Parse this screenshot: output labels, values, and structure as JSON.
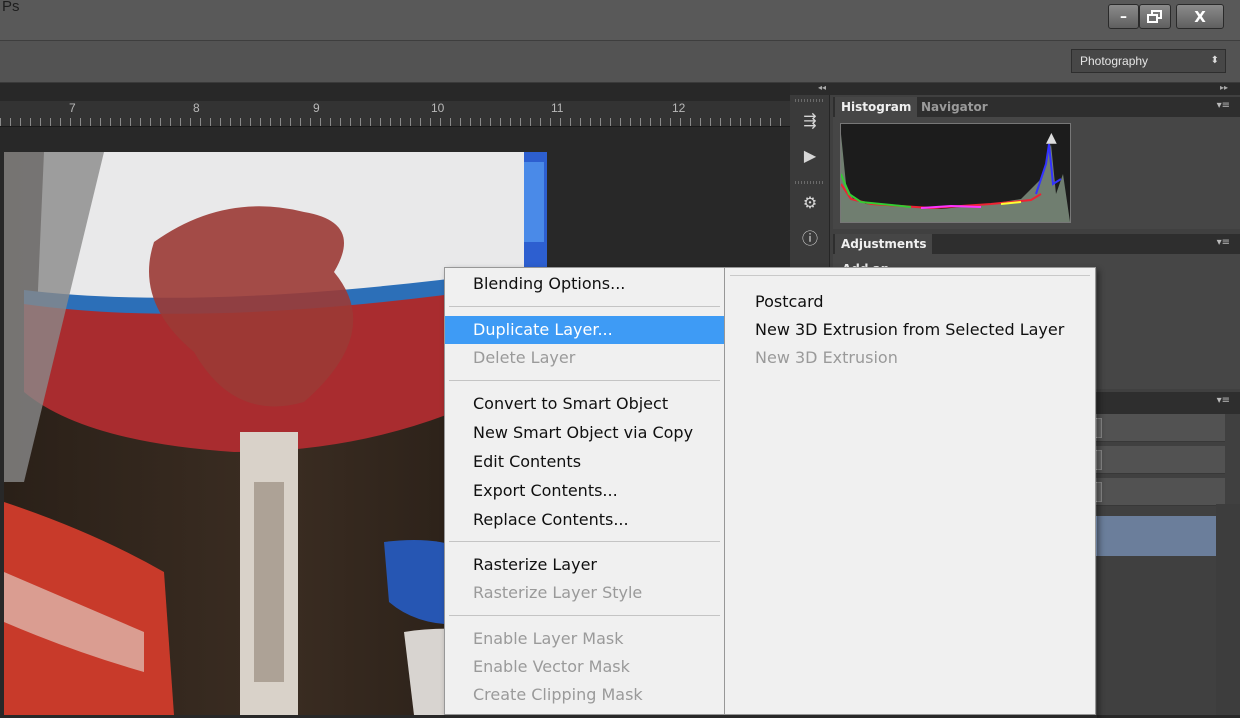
{
  "window": {
    "app_label": "Ps",
    "controls": {
      "minimize": "–",
      "restore": "🗗",
      "close": "X"
    }
  },
  "options_bar": {
    "workspace": {
      "selected": "Photography",
      "arrow": "⬍"
    }
  },
  "ruler": {
    "labels": [
      "7",
      "8",
      "9",
      "10",
      "11",
      "12"
    ]
  },
  "panel_collapse": {
    "left": "◂◂",
    "right": "▸▸"
  },
  "panels": {
    "histogram_tab": "Histogram",
    "navigator_tab": "Navigator",
    "histogram_warning": "▲",
    "adjustments_tab": "Adjustments",
    "adjustments_heading": "Add an adjustment",
    "panel_menu_glyph": "▾≡"
  },
  "icons": {
    "history": "⇶",
    "actions": "▶",
    "properties": "⚙",
    "info": "ⓘ"
  },
  "context_menu": {
    "blending_options": "Blending Options...",
    "duplicate_layer": "Duplicate Layer...",
    "delete_layer": "Delete Layer",
    "convert_smart_object": "Convert to Smart Object",
    "new_smart_object_copy": "New Smart Object via Copy",
    "edit_contents": "Edit Contents",
    "export_contents": "Export Contents...",
    "replace_contents": "Replace Contents...",
    "rasterize_layer": "Rasterize Layer",
    "rasterize_layer_style": "Rasterize Layer Style",
    "enable_layer_mask": "Enable Layer Mask",
    "enable_vector_mask": "Enable Vector Mask",
    "create_clipping_mask": "Create Clipping Mask"
  },
  "submenu": {
    "postcard": "Postcard",
    "extrusion_selected": "New 3D Extrusion from Selected Layer",
    "extrusion": "New 3D Extrusion"
  },
  "colors": {
    "menu_highlight": "#3e9bf5",
    "menu_background": "#f0f0f0",
    "layer_selected": "#6b7e9b"
  }
}
